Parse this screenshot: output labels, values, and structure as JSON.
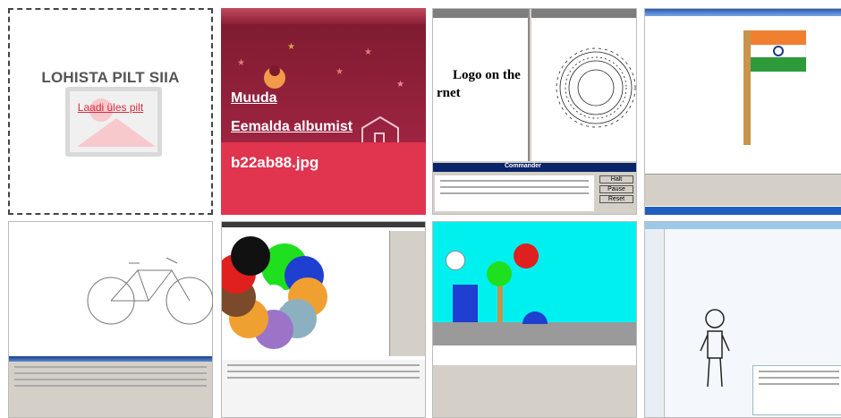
{
  "dropzone": {
    "title": "LOHISTA PILT SIIA",
    "upload_link": "Laadi üles pilt"
  },
  "selected_photo": {
    "actions": [
      "Muuda",
      "Eemalda albumist"
    ],
    "filename": "b22ab88.jpg"
  },
  "thumb_logo": {
    "heading_line1": "Logo on the",
    "heading_line2": "rnet",
    "panel_title": "Commander",
    "buttons": [
      "Halt",
      "Pause",
      "Reset"
    ]
  },
  "colors": {
    "accent": "#e0344f",
    "link": "#d92a3a",
    "dropzone_border": "#444444"
  }
}
